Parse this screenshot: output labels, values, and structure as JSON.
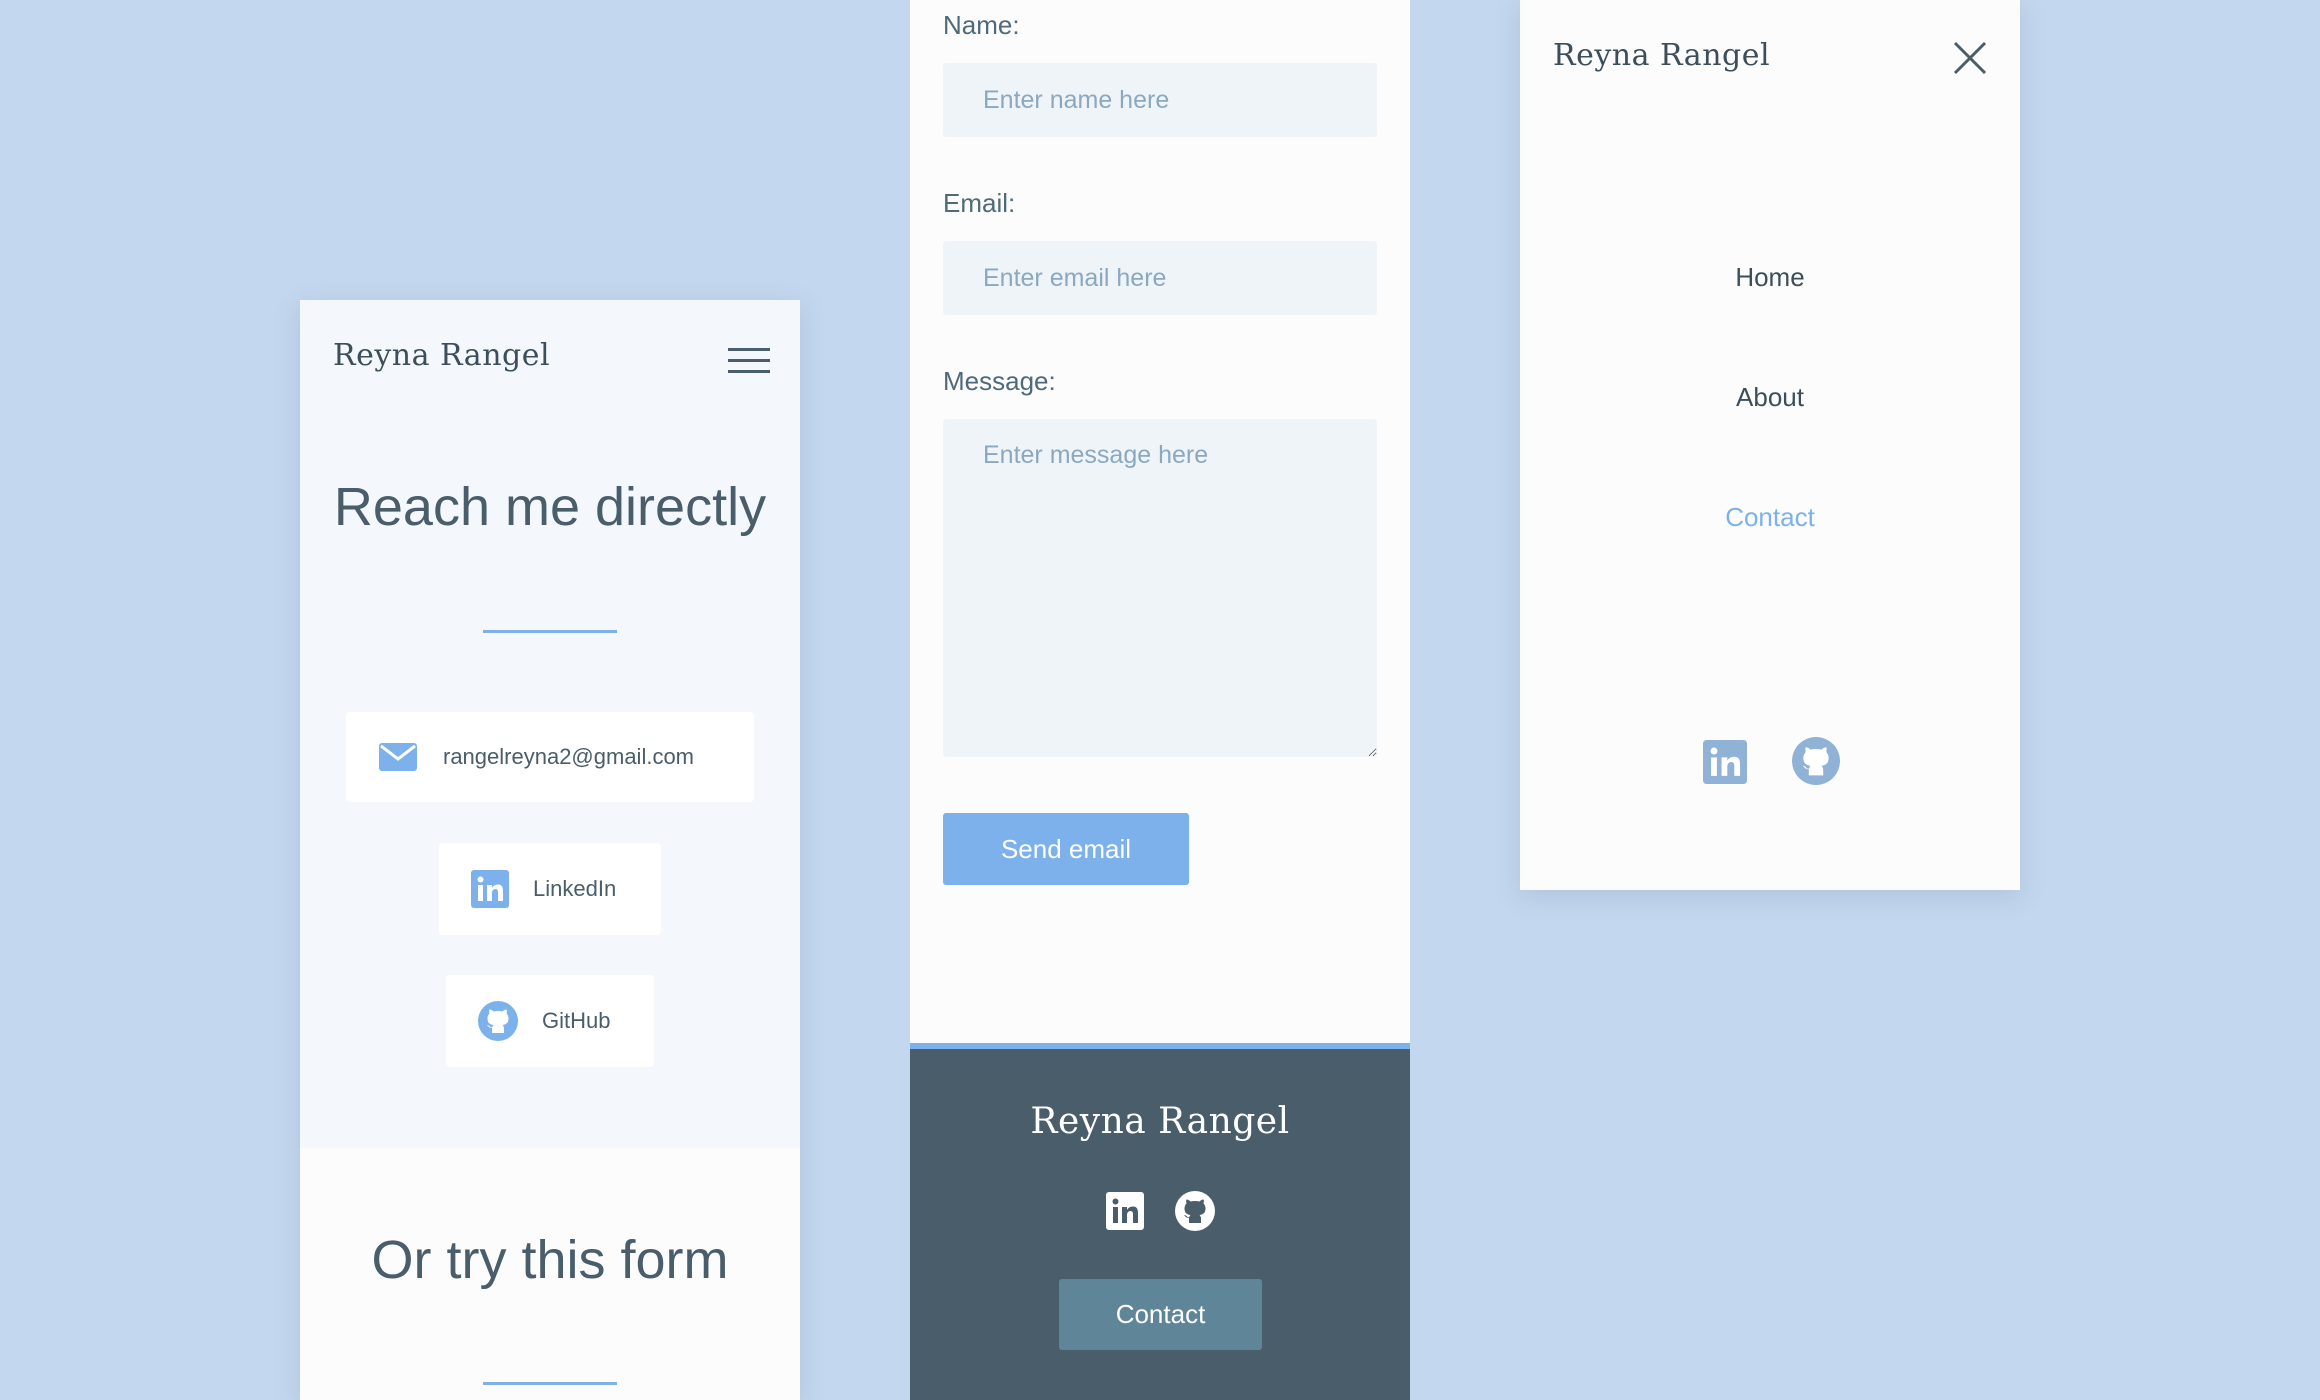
{
  "brand": "Reyna Rangel",
  "colors": {
    "background": "#c3d7ee",
    "accent": "#7cb1eb",
    "text": "#4a5d6a",
    "footer": "#4a5d6a",
    "footer_button": "#5f8599",
    "input_bg": "#eff4f8"
  },
  "contact_page": {
    "menu_icon": "hamburger-menu-icon",
    "hero_title": "Reach me directly",
    "email": {
      "icon": "envelope-icon",
      "label": "rangelreyna2@gmail.com"
    },
    "linkedin": {
      "icon": "linkedin-icon",
      "label": "LinkedIn"
    },
    "github": {
      "icon": "github-icon",
      "label": "GitHub"
    },
    "form_title": "Or try this form"
  },
  "form": {
    "name_label": "Name:",
    "name_placeholder": "Enter name here",
    "email_label": "Email:",
    "email_placeholder": "Enter email here",
    "message_label": "Message:",
    "message_placeholder": "Enter message here",
    "submit_label": "Send email"
  },
  "footer": {
    "brand": "Reyna Rangel",
    "icons": [
      "linkedin-icon",
      "github-icon"
    ],
    "contact_label": "Contact"
  },
  "menu": {
    "close_icon": "close-icon",
    "items": [
      {
        "label": "Home",
        "active": false
      },
      {
        "label": "About",
        "active": false
      },
      {
        "label": "Contact",
        "active": true
      }
    ],
    "icons": [
      "linkedin-icon",
      "github-icon"
    ]
  }
}
